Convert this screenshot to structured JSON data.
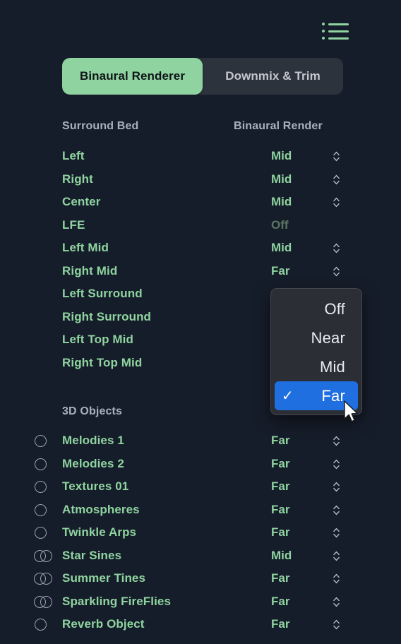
{
  "toolbar": {
    "list_icon": "list-icon"
  },
  "tabs": {
    "items": [
      {
        "label": "Binaural Renderer",
        "active": true
      },
      {
        "label": "Downmix & Trim",
        "active": false
      }
    ]
  },
  "bed_section": {
    "header_left": "Surround Bed",
    "header_right": "Binaural Render",
    "rows": [
      {
        "name": "Left",
        "value": "Mid",
        "enabled": true
      },
      {
        "name": "Right",
        "value": "Mid",
        "enabled": true
      },
      {
        "name": "Center",
        "value": "Mid",
        "enabled": true
      },
      {
        "name": "LFE",
        "value": "Off",
        "enabled": false
      },
      {
        "name": "Left Mid",
        "value": "Mid",
        "enabled": true
      },
      {
        "name": "Right Mid",
        "value": "Far",
        "enabled": true
      },
      {
        "name": "Left Surround",
        "value": "",
        "enabled": true
      },
      {
        "name": "Right Surround",
        "value": "",
        "enabled": true
      },
      {
        "name": "Left Top Mid",
        "value": "",
        "enabled": true
      },
      {
        "name": "Right Top Mid",
        "value": "",
        "enabled": true
      }
    ]
  },
  "objects_section": {
    "header": "3D Objects",
    "rows": [
      {
        "name": "Melodies 1",
        "value": "Far",
        "icon": "mono-circle-icon"
      },
      {
        "name": "Melodies 2",
        "value": "Far",
        "icon": "mono-circle-icon"
      },
      {
        "name": "Textures 01",
        "value": "Far",
        "icon": "mono-circle-icon"
      },
      {
        "name": "Atmospheres",
        "value": "Far",
        "icon": "mono-circle-icon"
      },
      {
        "name": "Twinkle Arps",
        "value": "Far",
        "icon": "mono-circle-icon"
      },
      {
        "name": "Star Sines",
        "value": "Mid",
        "icon": "stereo-circles-icon"
      },
      {
        "name": "Summer Tines",
        "value": "Far",
        "icon": "stereo-circles-icon"
      },
      {
        "name": "Sparkling FireFlies",
        "value": "Far",
        "icon": "stereo-circles-icon"
      },
      {
        "name": "Reverb Object",
        "value": "Far",
        "icon": "mono-circle-icon"
      }
    ]
  },
  "dropdown": {
    "options": [
      {
        "label": "Off",
        "selected": false
      },
      {
        "label": "Near",
        "selected": false
      },
      {
        "label": "Mid",
        "selected": false
      },
      {
        "label": "Far",
        "selected": true
      }
    ],
    "checkmark": "✓"
  },
  "colors": {
    "background": "#161d2a",
    "accent_green": "#8fd4a0",
    "dim_green": "#5c7563",
    "header_gray": "#a8b0bd",
    "selection_blue": "#1f6fe0",
    "segment_track": "#2d333d",
    "popup_bg": "#2b2e34"
  }
}
